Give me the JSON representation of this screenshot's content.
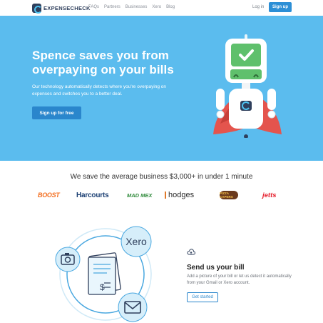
{
  "nav": {
    "logo_text": "EXPENSECHECK",
    "links": [
      "FAQs",
      "Partners",
      "Businesses",
      "Xero",
      "Blog"
    ],
    "login": "Log in",
    "signup": "Sign up"
  },
  "hero": {
    "title": "Spence saves you from overpaying on your bills",
    "subtitle": "Our technology automatically detects where you're overpaying on expenses and switches you to a better deal.",
    "cta": "Sign up for free",
    "colors": {
      "background": "#5bbcee",
      "button": "#2a86cc"
    }
  },
  "savings": {
    "title": "We save the average business $3,000+ in under 1 minute",
    "brands": [
      "BOOST",
      "Harcourts",
      "MAD MEX",
      "hodges",
      "PIZZA CAPERS",
      "jetts"
    ]
  },
  "feature": {
    "illustration_badge": "Xero",
    "illustration_currency": "$",
    "title": "Send us your bill",
    "description": "Add a picture of your bill or let us detect it automatically from your Gmail or Xero account.",
    "cta": "Get started"
  },
  "icons": [
    "logo-mark",
    "check-icon",
    "camera-icon",
    "document-icon",
    "mail-icon",
    "cloud-upload-icon"
  ]
}
